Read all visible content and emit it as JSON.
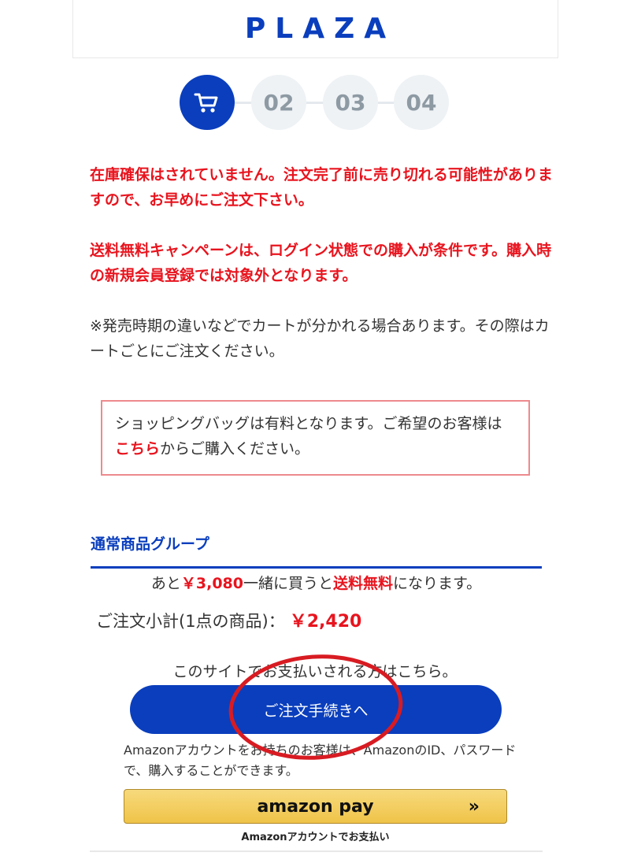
{
  "header": {
    "logo_text": "PLAZA"
  },
  "steps": [
    {
      "label": "",
      "icon": "cart-icon",
      "active": true
    },
    {
      "label": "02",
      "active": false
    },
    {
      "label": "03",
      "active": false
    },
    {
      "label": "04",
      "active": false
    }
  ],
  "notices": {
    "stock": "在庫確保はされていません。注文完了前に売り切れる可能性がありますので、お早めにご注文下さい。",
    "shipping": "送料無料キャンペーンは、ログイン状態での購入が条件です。購入時の新規会員登録では対象外となります。",
    "split_cart": "※発売時期の違いなどでカートが分かれる場合あります。その際はカートごとにご注文ください。"
  },
  "bag_notice": {
    "text_before": "ショッピングバッグは有料となります。ご希望のお客様は",
    "link_label": "こちら",
    "text_after": "からご購入ください。"
  },
  "cart_group": {
    "title": "通常商品グループ",
    "free_shipping_prefix": "あと",
    "free_shipping_amount": "￥3,080",
    "free_shipping_middle": "一緒に買うと",
    "free_shipping_label": "送料無料",
    "free_shipping_suffix": "になります。",
    "subtotal_label": "ご注文小計(1点の商品)：",
    "subtotal_value": "￥2,420"
  },
  "checkout": {
    "site_pay_text": "このサイトでお支払いされる方はこちら。",
    "order_button_label": "ご注文手続きへ",
    "amazon_note": "Amazonアカウントをお持ちのお客様は、AmazonのID、パスワードで、購入することができます。",
    "amazon_logo_text": "amazon pay",
    "amazon_arrows": "»",
    "amazon_caption": "Amazonアカウントでお支払い"
  },
  "colors": {
    "brand_blue": "#0a3ebd",
    "alert_red": "#e8141e",
    "step_inactive": "#eef2f5",
    "amazon_gold": "#f2ca55",
    "annotation_red": "#d81b22"
  }
}
